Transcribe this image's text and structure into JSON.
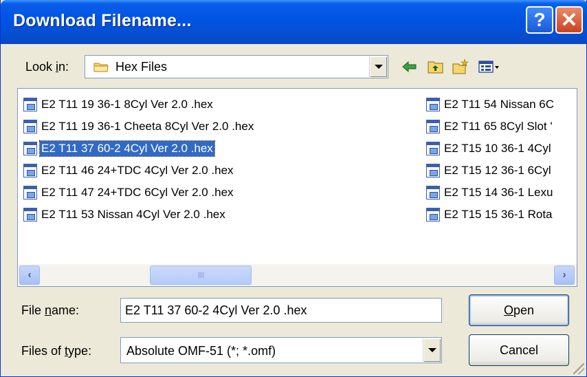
{
  "window": {
    "title": "Download Filename...",
    "help_glyph": "?",
    "close_glyph": "✕"
  },
  "look_in": {
    "label_pre": "Look ",
    "label_key": "i",
    "label_post": "n:",
    "value": "Hex Files",
    "icon": "folder-icon"
  },
  "toolbar": {
    "icons": [
      "back-arrow-icon",
      "up-folder-icon",
      "new-folder-icon",
      "view-menu-icon"
    ]
  },
  "files": {
    "left": [
      {
        "name": "E2 T11 19 36-1 8Cyl Ver 2.0 .hex",
        "selected": false
      },
      {
        "name": "E2 T11 19 36-1 Cheeta 8Cyl Ver 2.0 .hex",
        "selected": false
      },
      {
        "name": "E2 T11 37 60-2 4Cyl Ver 2.0 .hex",
        "selected": true
      },
      {
        "name": "E2 T11 46 24+TDC 4Cyl Ver 2.0 .hex",
        "selected": false
      },
      {
        "name": "E2 T11 47 24+TDC 6Cyl Ver 2.0 .hex",
        "selected": false
      },
      {
        "name": "E2 T11 53 Nissan 4Cyl Ver 2.0 .hex",
        "selected": false
      }
    ],
    "right": [
      {
        "name": "E2 T11 54 Nissan 6C"
      },
      {
        "name": "E2 T11 65 8Cyl Slot '"
      },
      {
        "name": "E2 T15 10 36-1 4Cyl"
      },
      {
        "name": "E2 T15 12 36-1 6Cyl"
      },
      {
        "name": "E2 T15 14 36-1 Lexu"
      },
      {
        "name": "E2 T15 15 36-1 Rota"
      }
    ]
  },
  "scrollbar": {
    "left_glyph": "‹",
    "right_glyph": "›",
    "thumb_grip": "IIII"
  },
  "file_name": {
    "label_pre": "File ",
    "label_key": "n",
    "label_post": "ame:",
    "value": "E2 T11 37 60-2 4Cyl Ver 2.0 .hex"
  },
  "file_type": {
    "label_pre": "Files of ",
    "label_key": "t",
    "label_post": "ype:",
    "value": "Absolute OMF-51 (*; *.omf)"
  },
  "buttons": {
    "open_key": "O",
    "open_rest": "pen",
    "cancel": "Cancel"
  }
}
